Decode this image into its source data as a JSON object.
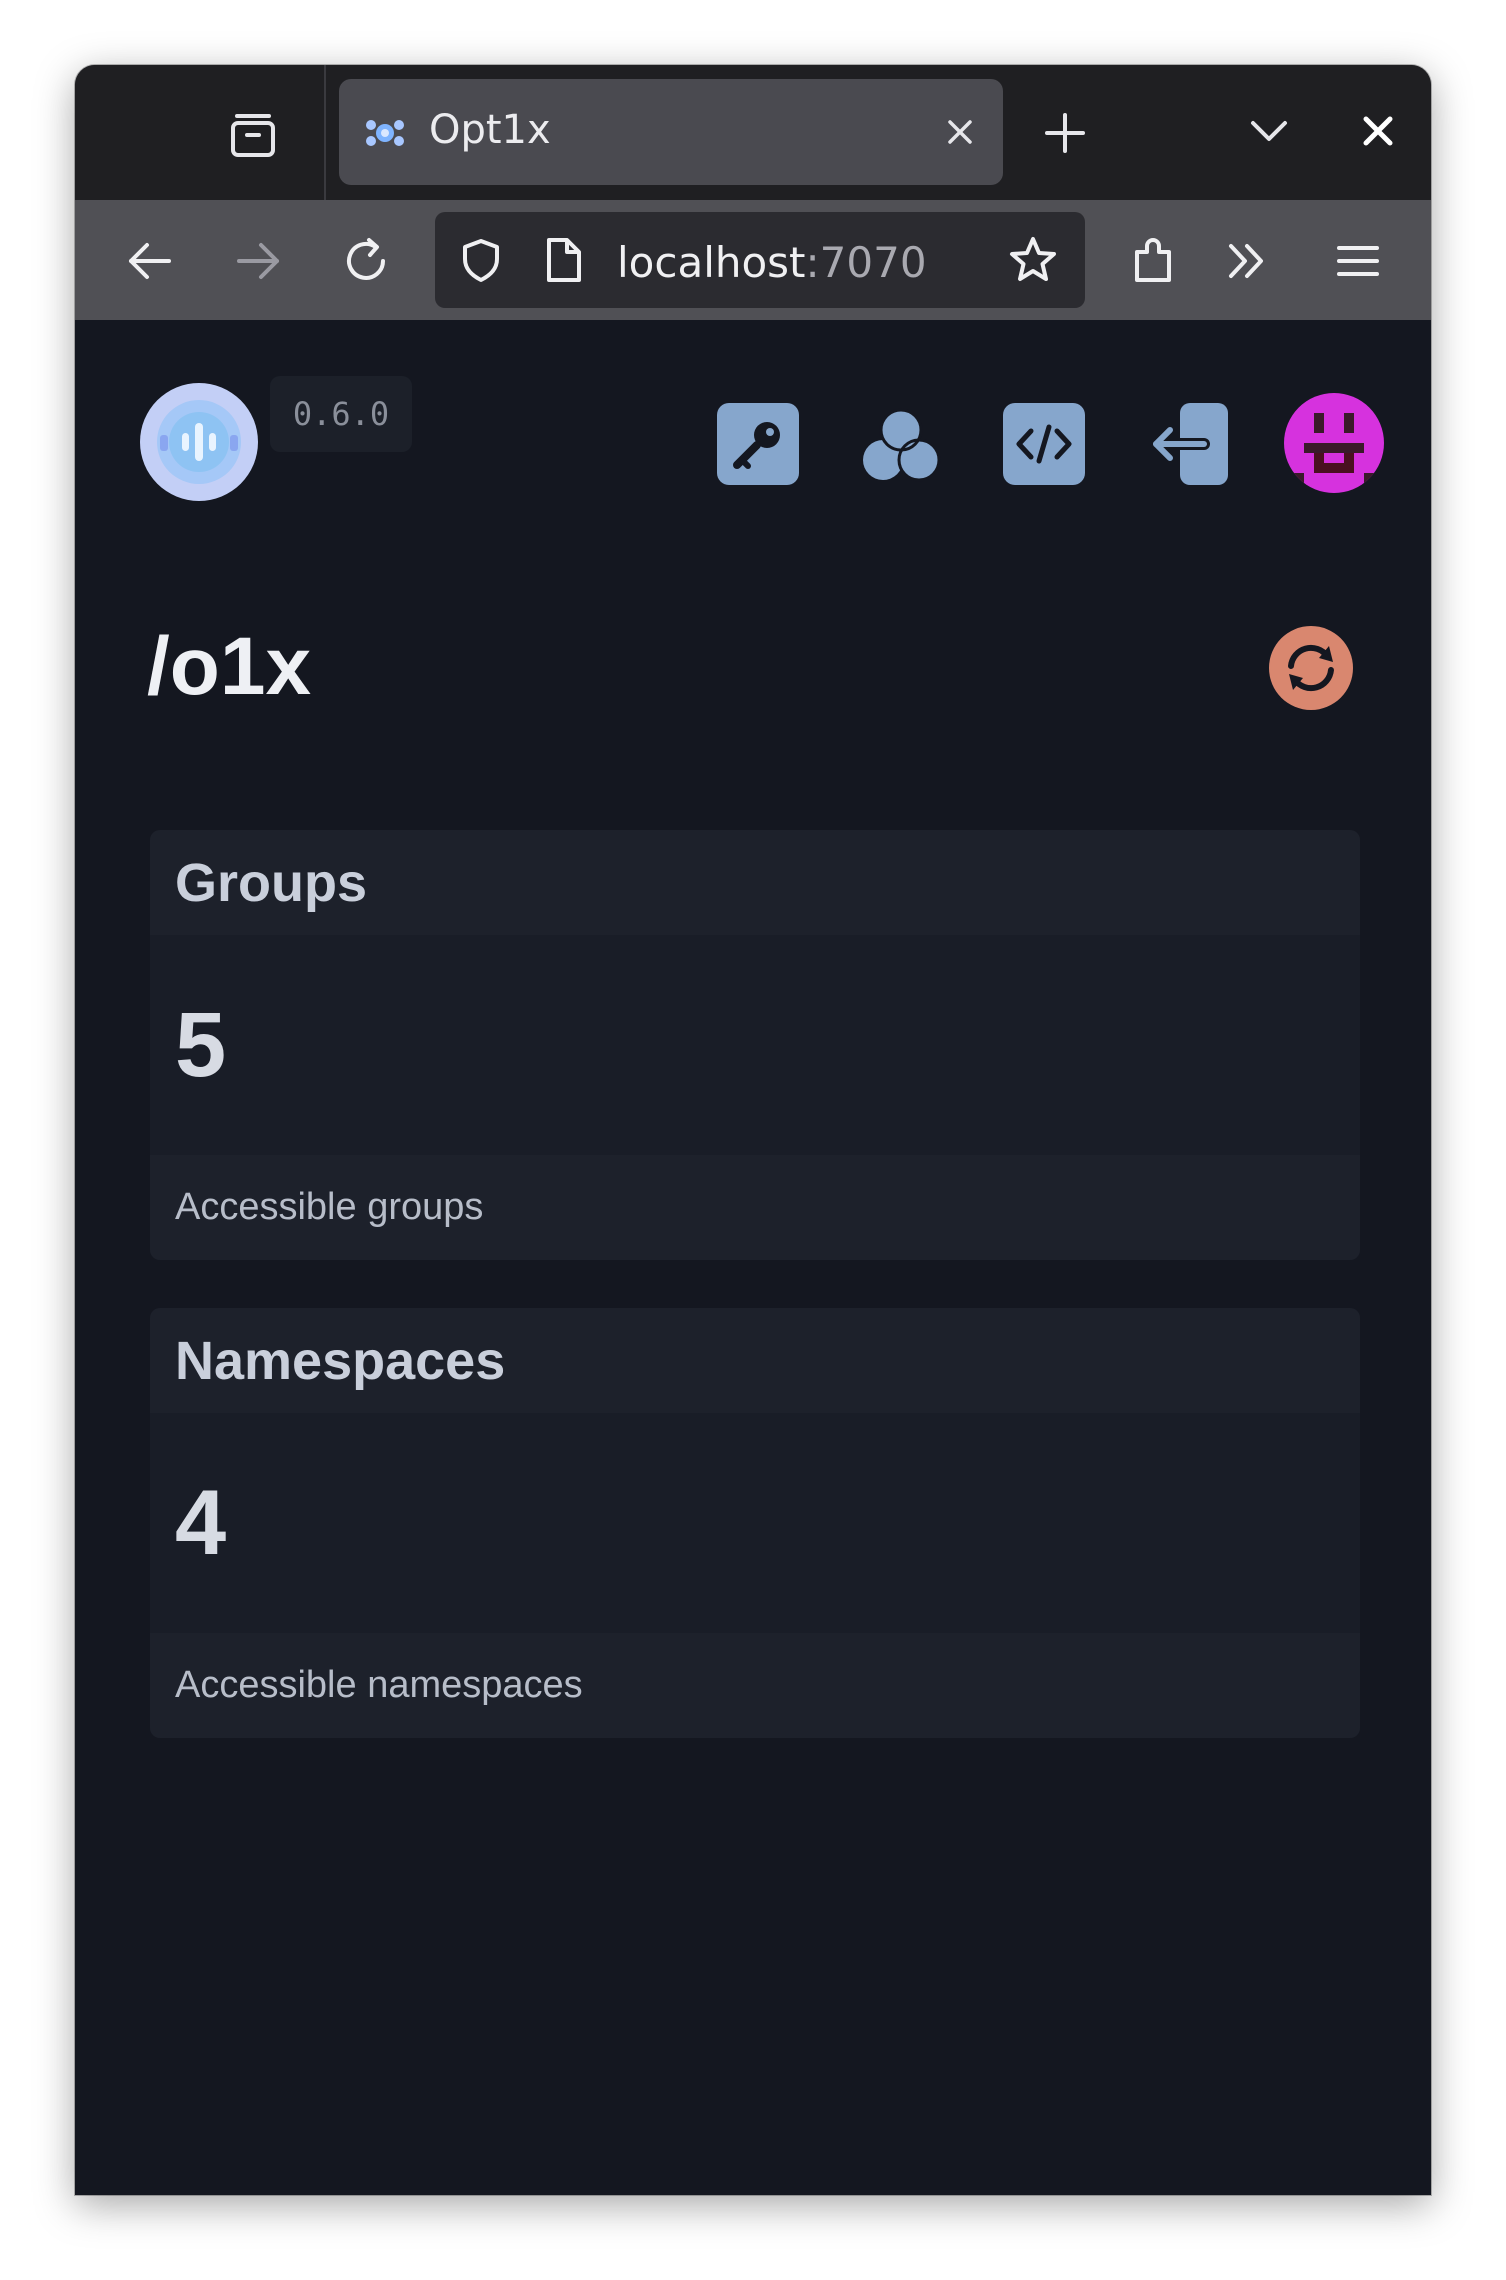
{
  "browser": {
    "tab_title": "Opt1x",
    "url_host": "localhost",
    "url_port": ":7070"
  },
  "header": {
    "version": "0.6.0",
    "icons": [
      "key-icon",
      "groups-icon",
      "code-icon",
      "logout-icon",
      "avatar"
    ]
  },
  "main": {
    "title": "/o1x",
    "cards": [
      {
        "title": "Groups",
        "value": "5",
        "description": "Accessible groups"
      },
      {
        "title": "Namespaces",
        "value": "4",
        "description": "Accessible namespaces"
      }
    ]
  },
  "colors": {
    "accent": "#86a6cc",
    "refresh": "#d9876f",
    "avatar": "#d632de",
    "background": "#141720"
  }
}
